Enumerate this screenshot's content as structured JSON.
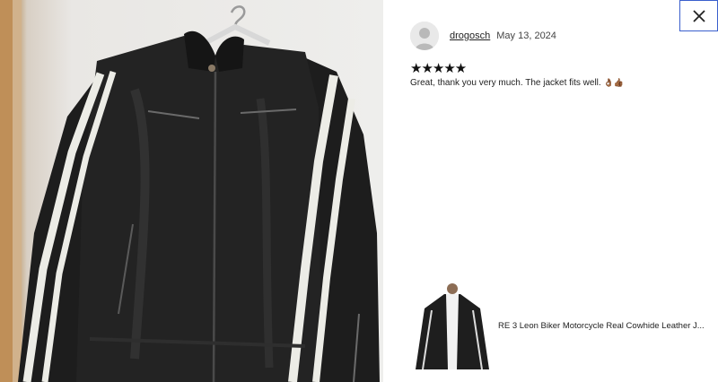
{
  "review": {
    "reviewer_name": "drogosch",
    "date": "May 13, 2024",
    "rating": 5,
    "stars_display": "★★★★★",
    "text": "Great, thank you very much. The jacket fits well.",
    "emoji": "👌🏾👍🏾"
  },
  "product": {
    "title": "RE 3 Leon Biker Motorcycle Real Cowhide Leather J..."
  },
  "icons": {
    "close": "close-icon",
    "avatar": "default-avatar-icon"
  },
  "colors": {
    "close_border": "#3a5fcd",
    "jacket": "#1f1f1f",
    "stripe": "#efefea"
  }
}
